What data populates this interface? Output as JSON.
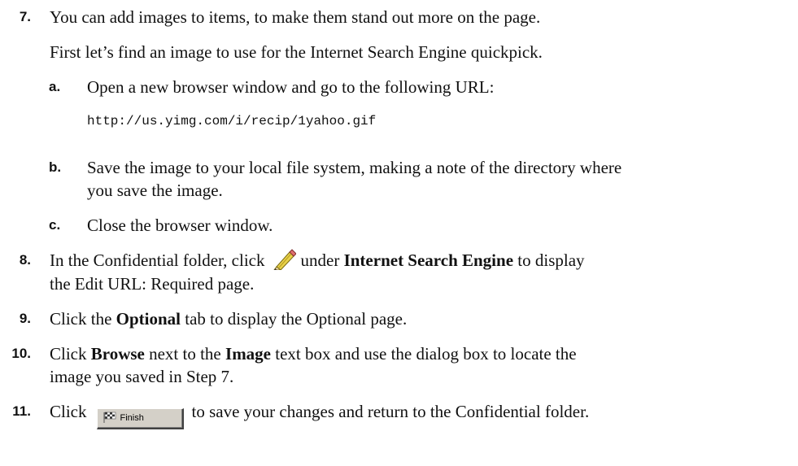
{
  "steps": {
    "s7": {
      "number": "7.",
      "line1": "You can add images to items, to make them stand out more on the page.",
      "line2": "First let’s find an image to use for the Internet Search Engine quickpick.",
      "a": {
        "letter": "a.",
        "text": "Open a new browser window and go to the following URL:",
        "url": "http://us.yimg.com/i/recip/1yahoo.gif"
      },
      "b": {
        "letter": "b.",
        "text": "Save the image to your local file system, making a note of the directory where you save the image."
      },
      "c": {
        "letter": "c.",
        "text": "Close the browser window."
      }
    },
    "s8": {
      "number": "8.",
      "pre": "In the Confidential folder, click",
      "mid": "under",
      "bold": "Internet Search Engine",
      "post1": "to display",
      "line2": "the  Edit URL: Required page.",
      "icon": "pencil-edit-icon"
    },
    "s9": {
      "number": "9.",
      "pre": "Click the",
      "bold": "Optional",
      "post": "tab to display the Optional page."
    },
    "s10": {
      "number": "10.",
      "pre": "Click",
      "bold1": "Browse",
      "mid": "next to the",
      "bold2": "Image",
      "post1": "text box and use the dialog box to locate the",
      "line2": "image you saved in Step 7."
    },
    "s11": {
      "number": "11.",
      "pre": "Click",
      "button_label": "Finish",
      "button_icon": "checkered-flag-icon",
      "post": "to save your changes and return to the Confidential folder."
    }
  }
}
